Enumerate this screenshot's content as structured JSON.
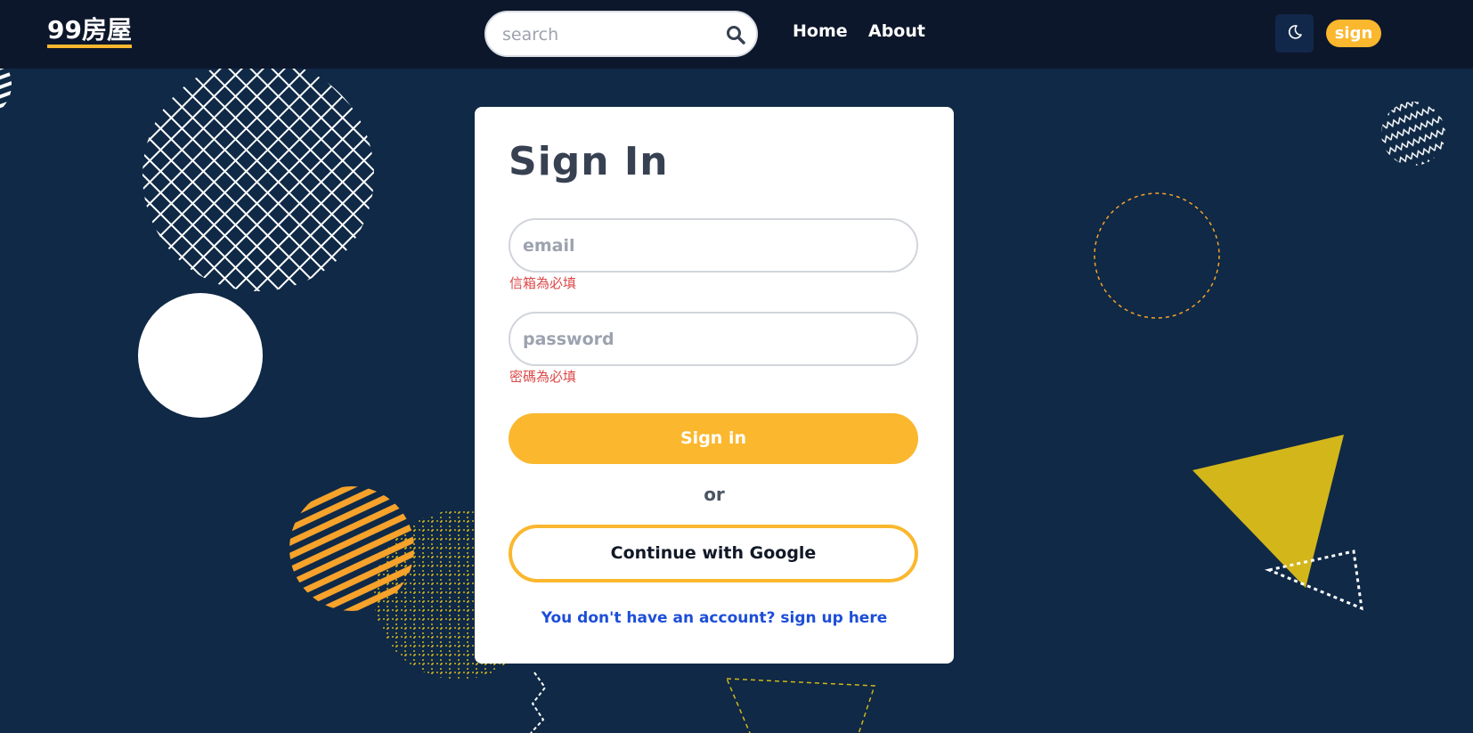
{
  "header": {
    "logo": "99房屋",
    "search": {
      "placeholder": "search",
      "value": ""
    },
    "nav": [
      {
        "label": "Home"
      },
      {
        "label": "About"
      }
    ],
    "theme_toggle_icon": "moon-icon",
    "sign_label": "sign"
  },
  "form": {
    "title": "Sign In",
    "email": {
      "placeholder": "email",
      "value": "",
      "error": "信箱為必填"
    },
    "password": {
      "placeholder": "password",
      "value": "",
      "error": "密碼為必填"
    },
    "submit_label": "Sign in",
    "divider": "or",
    "google_label": "Continue with Google",
    "signup_link": "You don't have an account? sign up here"
  },
  "colors": {
    "background": "#0f2946",
    "navbar": "#0d172b",
    "accent": "#fbb72e",
    "error": "#dc4a4a",
    "link": "#1d4ed8"
  }
}
